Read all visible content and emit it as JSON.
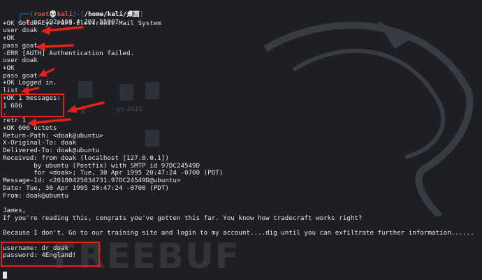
{
  "prompt": {
    "bracket_open": "┌──(",
    "user": "root💀kali",
    "bracket_mid": ")-[",
    "path": "/home/kali/桌面",
    "bracket_close": "]",
    "marker": "└─",
    "hash": "#",
    "command": "nc 192.168.4.202 55007"
  },
  "output_lines": [
    "+OK GoldenEye POP3 Electronic-Mail System",
    "user doak",
    "+OK",
    "pass goat",
    "-ERR [AUTH] Authentication failed.",
    "user doak",
    "+OK",
    "pass goat",
    "+OK Logged in.",
    "list",
    "+OK 1 messages:",
    "1 606",
    ".",
    "retr 1",
    "+OK 606 octets",
    "Return-Path: <doak@ubuntu>",
    "X-Original-To: doak",
    "Delivered-To: doak@ubuntu",
    "Received: from doak (localhost [127.0.0.1])",
    "        by ubuntu (Postfix) with SMTP id 97DC24549D",
    "        for <doak>; Tue, 30 Apr 1995 20:47:24 -0700 (PDT)",
    "Message-Id: <20180425034731.97DC24549D@ubuntu>",
    "Date: Tue, 30 Apr 1995 20:47:24 -0700 (PDT)",
    "From: doak@ubuntu",
    "",
    "James,",
    "If you're reading this, congrats you've gotten this far. You know how tradecraft works right?",
    "",
    "Because I don't. Go to our training site and login to my account....dig until you can exfiltrate further information......",
    "",
    "username: dr_doak",
    "password: 4England!"
  ],
  "desktop_labels": [
    "文",
    "ye-2021",
    "e"
  ],
  "watermark": "FREEBUF",
  "colors": {
    "background": "#1d1f24",
    "text": "#e4e6ea",
    "prompt_blue": "#2f7fe8",
    "prompt_red": "#ea4b4b",
    "annotation_red": "#e8201a"
  }
}
